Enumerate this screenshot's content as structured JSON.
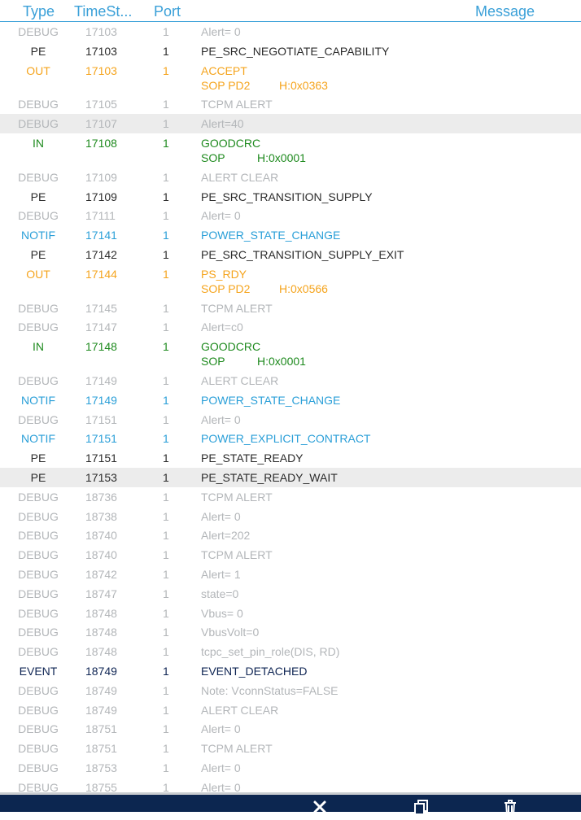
{
  "header": {
    "type_label": "Type",
    "timestamp_label": "TimeSt...",
    "port_label": "Port",
    "message_label": "Message"
  },
  "colors": {
    "DEBUG": "#b3b6b9",
    "PE": "#2b2b2b",
    "OUT": "#f5a41d",
    "IN": "#1e8a1e",
    "NOTIF": "#2a9fd8",
    "EVENT": "#0e2453",
    "header_accent": "#3aa0d8",
    "bottom_bar": "#0c2650",
    "row_highlight": "#ececec"
  },
  "rows": [
    {
      "type": "DEBUG",
      "ts": "17103",
      "port": "1",
      "msg": "Alert= 0"
    },
    {
      "type": "PE",
      "ts": "17103",
      "port": "1",
      "msg": "PE_SRC_NEGOTIATE_CAPABILITY"
    },
    {
      "type": "OUT",
      "ts": "17103",
      "port": "1",
      "msg": "ACCEPT",
      "sub": {
        "a": "SOP PD2",
        "b": "H:0x0363"
      }
    },
    {
      "type": "DEBUG",
      "ts": "17105",
      "port": "1",
      "msg": "TCPM ALERT"
    },
    {
      "type": "DEBUG",
      "ts": "17107",
      "port": "1",
      "msg": "Alert=40",
      "highlight": true
    },
    {
      "type": "IN",
      "ts": "17108",
      "port": "1",
      "msg": "GOODCRC",
      "sub": {
        "a": "SOP",
        "b": "H:0x0001"
      }
    },
    {
      "type": "DEBUG",
      "ts": "17109",
      "port": "1",
      "msg": "ALERT CLEAR"
    },
    {
      "type": "PE",
      "ts": "17109",
      "port": "1",
      "msg": "PE_SRC_TRANSITION_SUPPLY"
    },
    {
      "type": "DEBUG",
      "ts": "17111",
      "port": "1",
      "msg": "Alert= 0"
    },
    {
      "type": "NOTIF",
      "ts": "17141",
      "port": "1",
      "msg": "POWER_STATE_CHANGE"
    },
    {
      "type": "PE",
      "ts": "17142",
      "port": "1",
      "msg": "PE_SRC_TRANSITION_SUPPLY_EXIT"
    },
    {
      "type": "OUT",
      "ts": "17144",
      "port": "1",
      "msg": "PS_RDY",
      "sub": {
        "a": "SOP PD2",
        "b": "H:0x0566"
      }
    },
    {
      "type": "DEBUG",
      "ts": "17145",
      "port": "1",
      "msg": "TCPM ALERT"
    },
    {
      "type": "DEBUG",
      "ts": "17147",
      "port": "1",
      "msg": "Alert=c0"
    },
    {
      "type": "IN",
      "ts": "17148",
      "port": "1",
      "msg": "GOODCRC",
      "sub": {
        "a": "SOP",
        "b": "H:0x0001"
      }
    },
    {
      "type": "DEBUG",
      "ts": "17149",
      "port": "1",
      "msg": "ALERT CLEAR"
    },
    {
      "type": "NOTIF",
      "ts": "17149",
      "port": "1",
      "msg": "POWER_STATE_CHANGE"
    },
    {
      "type": "DEBUG",
      "ts": "17151",
      "port": "1",
      "msg": "Alert= 0"
    },
    {
      "type": "NOTIF",
      "ts": "17151",
      "port": "1",
      "msg": "POWER_EXPLICIT_CONTRACT"
    },
    {
      "type": "PE",
      "ts": "17151",
      "port": "1",
      "msg": "PE_STATE_READY"
    },
    {
      "type": "PE",
      "ts": "17153",
      "port": "1",
      "msg": "PE_STATE_READY_WAIT",
      "highlight": true
    },
    {
      "type": "DEBUG",
      "ts": "18736",
      "port": "1",
      "msg": "TCPM ALERT"
    },
    {
      "type": "DEBUG",
      "ts": "18738",
      "port": "1",
      "msg": "Alert= 0"
    },
    {
      "type": "DEBUG",
      "ts": "18740",
      "port": "1",
      "msg": "Alert=202"
    },
    {
      "type": "DEBUG",
      "ts": "18740",
      "port": "1",
      "msg": "TCPM ALERT"
    },
    {
      "type": "DEBUG",
      "ts": "18742",
      "port": "1",
      "msg": "Alert= 1"
    },
    {
      "type": "DEBUG",
      "ts": "18747",
      "port": "1",
      "msg": "state=0"
    },
    {
      "type": "DEBUG",
      "ts": "18748",
      "port": "1",
      "msg": "Vbus= 0"
    },
    {
      "type": "DEBUG",
      "ts": "18748",
      "port": "1",
      "msg": "VbusVolt=0"
    },
    {
      "type": "DEBUG",
      "ts": "18748",
      "port": "1",
      "msg": "tcpc_set_pin_role(DIS, RD)"
    },
    {
      "type": "EVENT",
      "ts": "18749",
      "port": "1",
      "msg": "EVENT_DETACHED"
    },
    {
      "type": "DEBUG",
      "ts": "18749",
      "port": "1",
      "msg": "Note: VconnStatus=FALSE"
    },
    {
      "type": "DEBUG",
      "ts": "18749",
      "port": "1",
      "msg": "ALERT CLEAR"
    },
    {
      "type": "DEBUG",
      "ts": "18751",
      "port": "1",
      "msg": "Alert= 0"
    },
    {
      "type": "DEBUG",
      "ts": "18751",
      "port": "1",
      "msg": "TCPM ALERT"
    },
    {
      "type": "DEBUG",
      "ts": "18753",
      "port": "1",
      "msg": "Alert= 0"
    },
    {
      "type": "DEBUG",
      "ts": "18755",
      "port": "1",
      "msg": "Alert= 0"
    }
  ],
  "toolbar": {
    "close_icon": "close-icon",
    "copy_icon": "copy-icon",
    "trash_icon": "trash-icon"
  }
}
